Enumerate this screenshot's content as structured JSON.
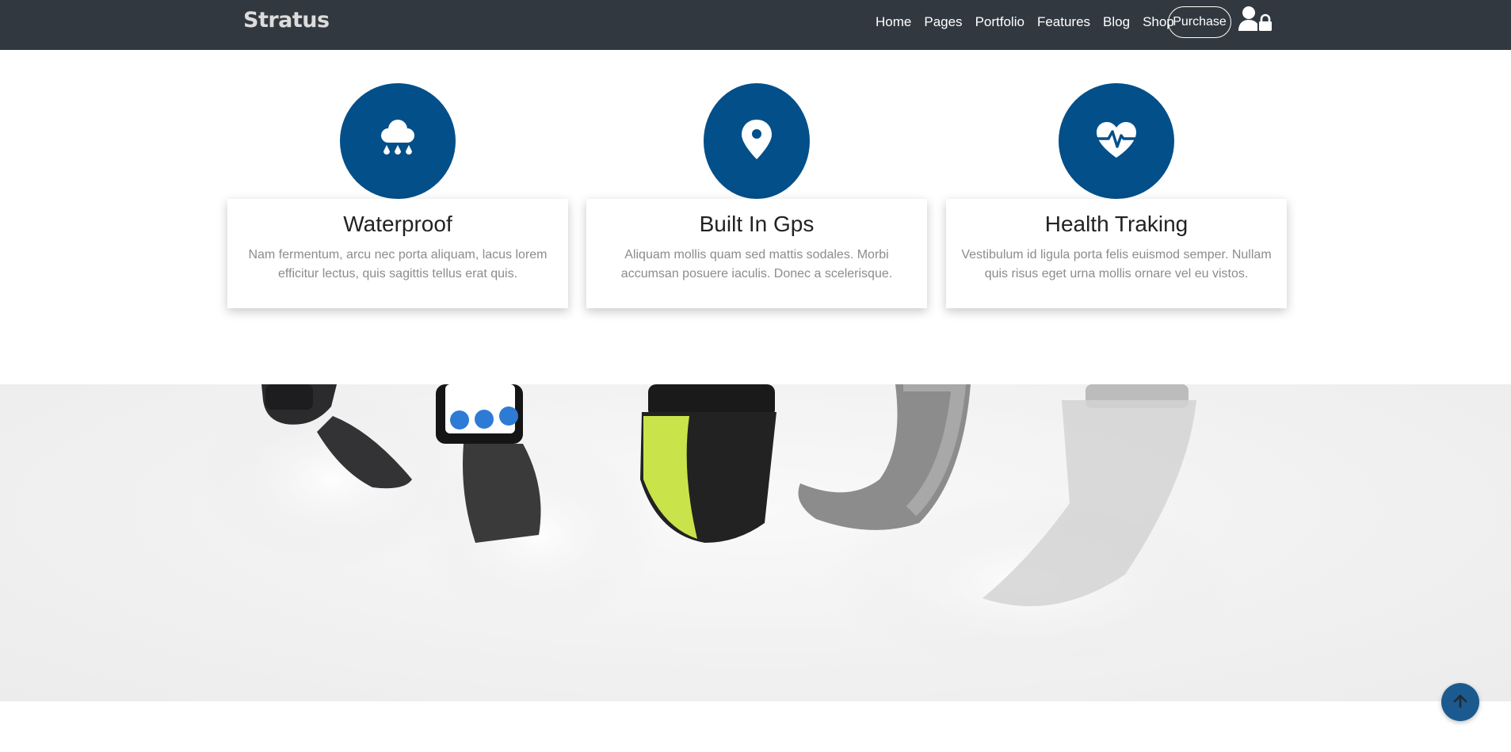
{
  "brand": {
    "name": "Stratus"
  },
  "nav": {
    "links": [
      {
        "label": "Home"
      },
      {
        "label": "Pages"
      },
      {
        "label": "Portfolio"
      },
      {
        "label": "Features"
      },
      {
        "label": "Blog"
      },
      {
        "label": "Shop"
      }
    ],
    "purchase_label": "Purchase",
    "account_icon": "user-lock-icon"
  },
  "features": [
    {
      "icon": "cloud-rain-icon",
      "title": "Waterproof",
      "text": "Nam fermentum, arcu nec porta aliquam, lacus lorem efficitur lectus, quis sagittis tellus erat quis."
    },
    {
      "icon": "map-pin-icon",
      "title": "Built In Gps",
      "text": "Aliquam mollis quam sed mattis sodales. Morbi accumsan posuere iaculis. Donec a scelerisque."
    },
    {
      "icon": "heartbeat-icon",
      "title": "Health Traking",
      "text": "Vestibulum id ligula porta felis euismod semper. Nullam quis risus eget urna mollis ornare vel eu vistos."
    }
  ],
  "hero": {
    "image": "smartwatches-in-water-photo"
  },
  "scroll_top": {
    "icon": "arrow-up-icon"
  },
  "colors": {
    "navbar_bg": "#323840",
    "accent": "#034f89",
    "scroll_button": "#1b5a8f",
    "card_text": "#8c8c8c"
  }
}
